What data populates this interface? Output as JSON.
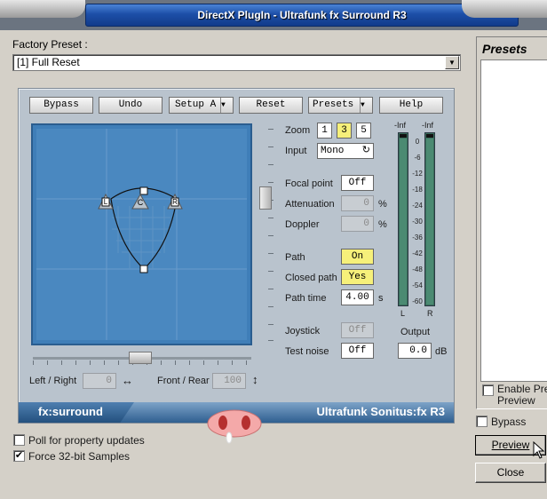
{
  "window": {
    "title": "DirectX PlugIn - Ultrafunk fx Surround R3"
  },
  "factory_preset": {
    "label": "Factory Preset :",
    "value": "[1] Full Reset"
  },
  "toolbar": {
    "bypass": "Bypass",
    "undo": "Undo",
    "setup": "Setup A",
    "reset": "Reset",
    "presets": "Presets",
    "help": "Help"
  },
  "controls": {
    "zoom_label": "Zoom",
    "zoom_options": [
      "1",
      "3",
      "5"
    ],
    "zoom_selected": "3",
    "input_label": "Input",
    "input_value": "Mono",
    "focal_label": "Focal point",
    "focal_value": "Off",
    "attenuation_label": "Attenuation",
    "attenuation_value": "0",
    "attenuation_unit": "%",
    "doppler_label": "Doppler",
    "doppler_value": "0",
    "doppler_unit": "%",
    "path_label": "Path",
    "path_value": "On",
    "closed_path_label": "Closed path",
    "closed_path_value": "Yes",
    "path_time_label": "Path time",
    "path_time_value": "4.00",
    "path_time_unit": "s",
    "joystick_label": "Joystick",
    "joystick_value": "Off",
    "test_noise_label": "Test noise",
    "test_noise_value": "Off"
  },
  "pad": {
    "labels": [
      "L",
      "C",
      "R"
    ]
  },
  "meters": {
    "left_peak": "-Inf",
    "right_peak": "-Inf",
    "scale": [
      "0",
      "-6",
      "-12",
      "-18",
      "-24",
      "-30",
      "-36",
      "-42",
      "-48",
      "-54",
      "-60"
    ],
    "left_label": "L",
    "right_label": "R",
    "output_label": "Output",
    "output_value": "0.0",
    "output_unit": "dB"
  },
  "position": {
    "left_right_label": "Left / Right",
    "left_right_value": "0",
    "front_rear_label": "Front / Rear",
    "front_rear_value": "100"
  },
  "branding": {
    "left": "fx:surround",
    "right": "Ultrafunk Sonitus:fx R3"
  },
  "options": {
    "poll_label": "Poll for property updates",
    "poll_checked": false,
    "force32_label": "Force 32-bit Samples",
    "force32_checked": true
  },
  "side": {
    "presets_title": "Presets",
    "enable_preview_label": "Enable Preview",
    "enable_preview_label_line1": "Enable Pre",
    "enable_preview_label_line2": "Preview",
    "bypass_label": "Bypass",
    "preview_button": "Preview",
    "close_button": "Close"
  }
}
